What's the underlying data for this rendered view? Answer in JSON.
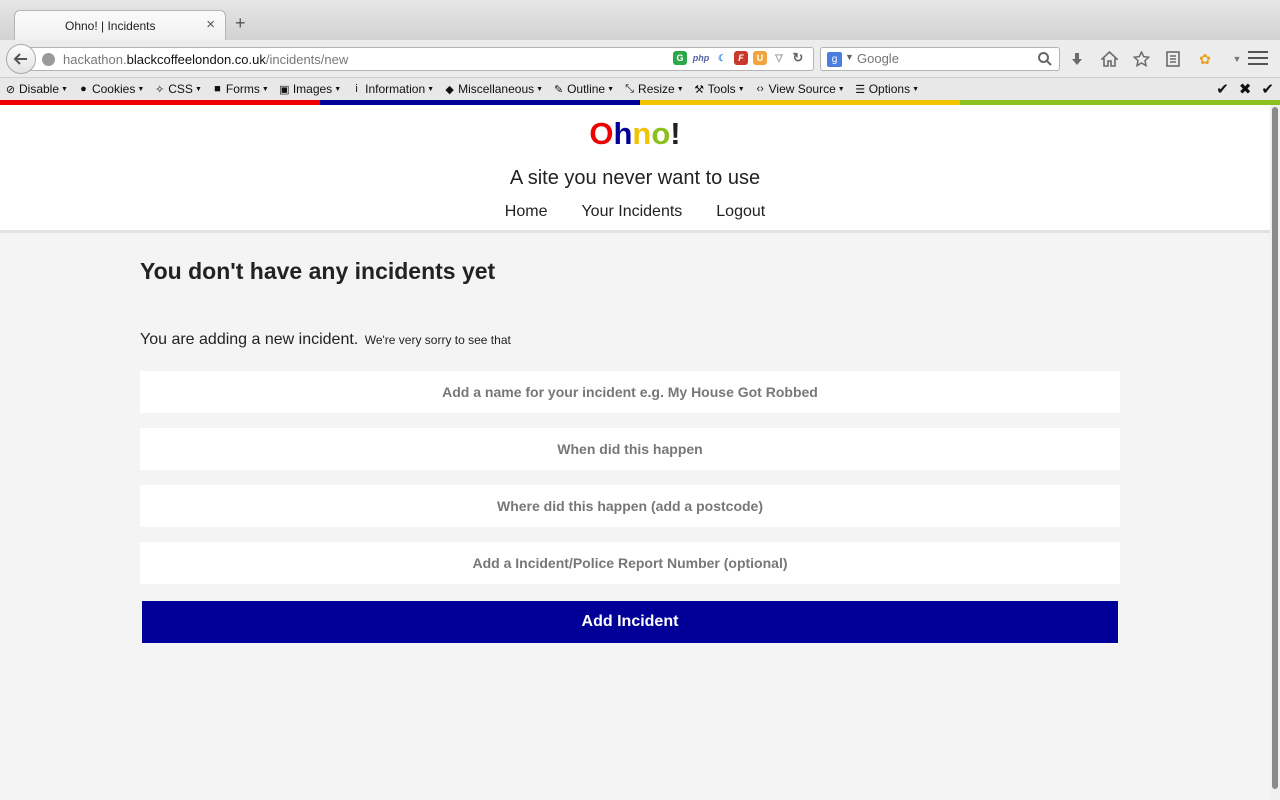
{
  "browser": {
    "tab_title": "Ohno! | Incidents",
    "tab_close": "×",
    "new_tab": "+",
    "url_prefix": "hackathon.",
    "url_domain": "blackcoffeelondon.co.uk",
    "url_path": "/incidents/new",
    "search_engine_badge": "g",
    "search_placeholder": "Google",
    "colors": {
      "red": "#ee0000",
      "blue": "#000099",
      "yellow": "#f2c400",
      "green": "#8cc01c"
    }
  },
  "devtools": {
    "items": [
      {
        "label": "Disable",
        "icon": "disable-icon"
      },
      {
        "label": "Cookies",
        "icon": "person-icon"
      },
      {
        "label": "CSS",
        "icon": "wand-icon"
      },
      {
        "label": "Forms",
        "icon": "forms-icon"
      },
      {
        "label": "Images",
        "icon": "image-icon"
      },
      {
        "label": "Information",
        "icon": "info-icon"
      },
      {
        "label": "Miscellaneous",
        "icon": "cube-icon"
      },
      {
        "label": "Outline",
        "icon": "pencil-icon"
      },
      {
        "label": "Resize",
        "icon": "resize-icon"
      },
      {
        "label": "Tools",
        "icon": "wrench-icon"
      },
      {
        "label": "View Source",
        "icon": "code-icon"
      },
      {
        "label": "Options",
        "icon": "sliders-icon"
      }
    ],
    "right_icons": [
      "✔",
      "✖",
      "✔"
    ]
  },
  "site": {
    "logo": [
      {
        "ch": "O",
        "color": "#ee0000"
      },
      {
        "ch": "h",
        "color": "#000099"
      },
      {
        "ch": "n",
        "color": "#f2c400"
      },
      {
        "ch": "o",
        "color": "#8cc01c"
      },
      {
        "ch": "!",
        "color": "#222222"
      }
    ],
    "tagline": "A site you never want to use",
    "nav": [
      "Home",
      "Your Incidents",
      "Logout"
    ]
  },
  "main": {
    "heading": "You don't have any incidents yet",
    "subline": "You are adding a new incident.",
    "subline_small": "We're very sorry to see that",
    "fields": [
      {
        "placeholder": "Add a name for your incident e.g. My House Got Robbed",
        "value": ""
      },
      {
        "placeholder": "When did this happen",
        "value": ""
      },
      {
        "placeholder": "Where did this happen (add a postcode)",
        "value": ""
      },
      {
        "placeholder": "Add a Incident/Police Report Number (optional)",
        "value": ""
      }
    ],
    "submit_label": "Add Incident",
    "accent_color": "#000099"
  }
}
